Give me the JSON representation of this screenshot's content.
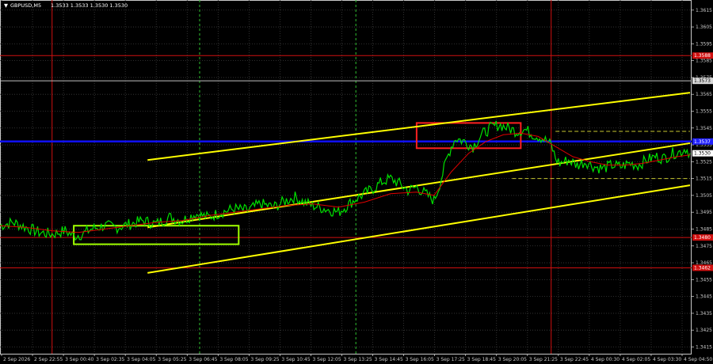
{
  "chart_data": {
    "type": "line",
    "title": "GBPUSD,M5",
    "ohlc_text": "1.3533 1.3533 1.3530 1.3530",
    "symbol_marker": "▼",
    "y_ticks": [
      "1.3615",
      "1.3605",
      "1.3595",
      "1.3585",
      "1.3575",
      "1.3565",
      "1.3555",
      "1.3545",
      "1.3535",
      "1.3525",
      "1.3515",
      "1.3505",
      "1.3495",
      "1.3485",
      "1.3475",
      "1.3465",
      "1.3455",
      "1.3445",
      "1.3435",
      "1.3425",
      "1.3415"
    ],
    "x_ticks": [
      "2 Sep 2026",
      "2 Sep 22:55",
      "3 Sep 00:40",
      "3 Sep 02:35",
      "3 Sep 04:05",
      "3 Sep 05:25",
      "3 Sep 06:45",
      "3 Sep 08:05",
      "3 Sep 09:25",
      "3 Sep 10:45",
      "3 Sep 12:05",
      "3 Sep 13:25",
      "3 Sep 14:45",
      "3 Sep 16:05",
      "3 Sep 17:25",
      "3 Sep 18:45",
      "3 Sep 20:05",
      "3 Sep 21:25",
      "3 Sep 22:45",
      "4 Sep 00:30",
      "4 Sep 02:05",
      "4 Sep 03:30",
      "4 Sep 04:50"
    ],
    "ylim": [
      1.3411,
      1.3621
    ],
    "price_series": [
      [
        0,
        1.3487
      ],
      [
        3,
        1.3489
      ],
      [
        6,
        1.3486
      ],
      [
        9,
        1.3483
      ],
      [
        12,
        1.3482
      ],
      [
        15,
        1.3484
      ],
      [
        17,
        1.3481
      ],
      [
        19,
        1.3482
      ],
      [
        21,
        1.3485
      ],
      [
        24,
        1.3487
      ],
      [
        27,
        1.3486
      ],
      [
        30,
        1.3488
      ],
      [
        33,
        1.349
      ],
      [
        36,
        1.3488
      ],
      [
        39,
        1.3492
      ],
      [
        42,
        1.349
      ],
      [
        45,
        1.3494
      ],
      [
        48,
        1.3492
      ],
      [
        51,
        1.3495
      ],
      [
        54,
        1.3497
      ],
      [
        57,
        1.3496
      ],
      [
        60,
        1.35
      ],
      [
        63,
        1.3498
      ],
      [
        66,
        1.3502
      ],
      [
        68,
        1.3504
      ],
      [
        70,
        1.3501
      ],
      [
        72,
        1.3499
      ],
      [
        75,
        1.3497
      ],
      [
        78,
        1.3495
      ],
      [
        80,
        1.3499
      ],
      [
        82,
        1.3503
      ],
      [
        84,
        1.3506
      ],
      [
        86,
        1.3509
      ],
      [
        88,
        1.3513
      ],
      [
        90,
        1.3515
      ],
      [
        92,
        1.3512
      ],
      [
        94,
        1.3508
      ],
      [
        96,
        1.351
      ],
      [
        98,
        1.3506
      ],
      [
        100,
        1.3502
      ],
      [
        101,
        1.3509
      ],
      [
        102,
        1.3518
      ],
      [
        103,
        1.3527
      ],
      [
        104,
        1.3534
      ],
      [
        105,
        1.3539
      ],
      [
        107,
        1.3537
      ],
      [
        109,
        1.3534
      ],
      [
        111,
        1.3541
      ],
      [
        113,
        1.3545
      ],
      [
        115,
        1.3547
      ],
      [
        117,
        1.3545
      ],
      [
        119,
        1.3543
      ],
      [
        121,
        1.3544
      ],
      [
        123,
        1.3541
      ],
      [
        125,
        1.3539
      ],
      [
        127,
        1.3535
      ],
      [
        128,
        1.3527
      ],
      [
        129,
        1.3524
      ],
      [
        131,
        1.3526
      ],
      [
        133,
        1.3523
      ],
      [
        135,
        1.3525
      ],
      [
        137,
        1.3522
      ],
      [
        139,
        1.3521
      ],
      [
        141,
        1.3523
      ],
      [
        143,
        1.3522
      ],
      [
        145,
        1.3524
      ],
      [
        147,
        1.3523
      ],
      [
        149,
        1.3526
      ],
      [
        151,
        1.3528
      ],
      [
        153,
        1.3527
      ],
      [
        155,
        1.353
      ],
      [
        157,
        1.3531
      ],
      [
        158,
        1.3533
      ],
      [
        159,
        1.353
      ]
    ],
    "ma_series": [
      [
        0,
        1.3487
      ],
      [
        6,
        1.3486
      ],
      [
        12,
        1.3484
      ],
      [
        18,
        1.3483
      ],
      [
        24,
        1.3485
      ],
      [
        30,
        1.3487
      ],
      [
        36,
        1.3489
      ],
      [
        42,
        1.349
      ],
      [
        48,
        1.3493
      ],
      [
        54,
        1.3495
      ],
      [
        60,
        1.3497
      ],
      [
        66,
        1.3499
      ],
      [
        72,
        1.35
      ],
      [
        78,
        1.3498
      ],
      [
        84,
        1.3501
      ],
      [
        90,
        1.3506
      ],
      [
        96,
        1.3507
      ],
      [
        100,
        1.3505
      ],
      [
        104,
        1.3519
      ],
      [
        108,
        1.353
      ],
      [
        112,
        1.3537
      ],
      [
        116,
        1.3541
      ],
      [
        120,
        1.3542
      ],
      [
        124,
        1.354
      ],
      [
        128,
        1.3534
      ],
      [
        132,
        1.3528
      ],
      [
        136,
        1.3525
      ],
      [
        140,
        1.3523
      ],
      [
        144,
        1.3523
      ],
      [
        148,
        1.3524
      ],
      [
        152,
        1.3526
      ],
      [
        156,
        1.3528
      ],
      [
        159,
        1.3529
      ]
    ],
    "trend_lines": [
      {
        "color": "#ffff00",
        "from": [
          34,
          1.3526
        ],
        "to": [
          159,
          1.3566
        ]
      },
      {
        "color": "#ffff00",
        "from": [
          34,
          1.3486
        ],
        "to": [
          159,
          1.3536
        ]
      },
      {
        "color": "#ffff00",
        "from": [
          34,
          1.3459
        ],
        "to": [
          159,
          1.3511
        ]
      }
    ],
    "horizontal_levels": [
      {
        "price": 1.3588,
        "color": "#d01010",
        "label": "1.3588"
      },
      {
        "price": 1.3573,
        "color": "#c0c0c0",
        "label": "1.3573",
        "label_color": "#000000",
        "label_bg": "#d8d8d8"
      },
      {
        "price": 1.3537,
        "color": "#1010ff",
        "label": "1.3537",
        "label_color": "#ffffff",
        "label_bg": "#2020ff"
      },
      {
        "price": 1.348,
        "color": "#d01010",
        "label": "1.3480"
      },
      {
        "price": 1.3462,
        "color": "#d01010",
        "label": "1.3462"
      }
    ],
    "current_price": {
      "price": 1.353,
      "label": "1.3530",
      "label_color": "#000000",
      "label_bg": "#ffffff"
    },
    "dashed_hlines": [
      {
        "price": 1.3543,
        "from": 128,
        "to": 159,
        "color": "#c8c830"
      },
      {
        "price": 1.3515,
        "from": 118,
        "to": 159,
        "color": "#c8c830"
      }
    ],
    "vertical_red": [
      12,
      127
    ],
    "vertical_green": [
      46,
      82
    ],
    "boxes": [
      {
        "color": "#a0ff00",
        "x0": 17,
        "x1": 55,
        "y0": 1.3487,
        "y1": 1.3476
      },
      {
        "color": "#ff2020",
        "x0": 96,
        "x1": 120,
        "y0": 1.3548,
        "y1": 1.3533
      }
    ],
    "colors": {
      "price": "#00e000",
      "ma": "#e00000",
      "background": "#000000",
      "grid": "#3c3c3c",
      "axis": "#c8c8c8"
    }
  }
}
